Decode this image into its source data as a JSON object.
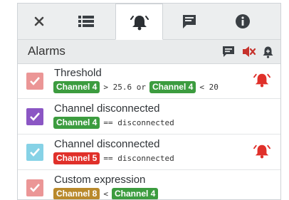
{
  "colors": {
    "channel4": "#3c9c3f",
    "channel5": "#e0302a",
    "channel8": "#b9892b",
    "check_red": "#eb9696",
    "check_purple": "#8b56c4",
    "check_cyan": "#86d2e6",
    "bell_red": "#e0302a"
  },
  "tabs": [
    {
      "icon": "close-icon"
    },
    {
      "icon": "list-icon"
    },
    {
      "icon": "alarm-bell-icon"
    },
    {
      "icon": "message-icon"
    },
    {
      "icon": "info-icon"
    }
  ],
  "header": {
    "title": "Alarms",
    "icons": [
      "message-icon",
      "mute-icon",
      "bell-plus-icon"
    ]
  },
  "alarms": [
    {
      "title": "Threshold",
      "checkbox_color": "#eb9696",
      "ringing": true,
      "expr": [
        {
          "type": "chip",
          "text": "Channel 4",
          "color": "#3c9c3f"
        },
        {
          "type": "op",
          "text": "> 25.6 or"
        },
        {
          "type": "chip",
          "text": "Channel 4",
          "color": "#3c9c3f"
        },
        {
          "type": "op",
          "text": "< 20"
        }
      ]
    },
    {
      "title": "Channel disconnected",
      "checkbox_color": "#8b56c4",
      "ringing": false,
      "expr": [
        {
          "type": "chip",
          "text": "Channel 4",
          "color": "#3c9c3f"
        },
        {
          "type": "op",
          "text": "== disconnected"
        }
      ]
    },
    {
      "title": "Channel disconnected",
      "checkbox_color": "#86d2e6",
      "ringing": true,
      "expr": [
        {
          "type": "chip",
          "text": "Channel 5",
          "color": "#e0302a"
        },
        {
          "type": "op",
          "text": "== disconnected"
        }
      ]
    },
    {
      "title": "Custom expression",
      "checkbox_color": "#eb9696",
      "ringing": false,
      "expr": [
        {
          "type": "chip",
          "text": "Channel 8",
          "color": "#b9892b"
        },
        {
          "type": "op",
          "text": "<"
        },
        {
          "type": "chip",
          "text": "Channel 4",
          "color": "#3c9c3f"
        }
      ]
    }
  ]
}
